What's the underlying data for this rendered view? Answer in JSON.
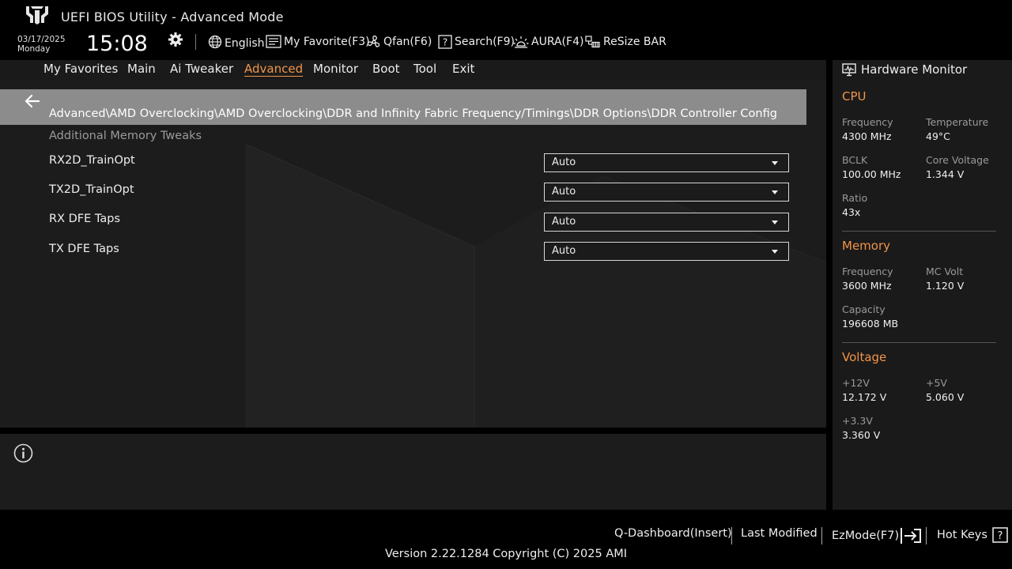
{
  "header": {
    "title": "UEFI BIOS Utility - Advanced Mode",
    "date": "03/17/2025",
    "day": "Monday",
    "time": "15:08",
    "tools": {
      "language": "English",
      "favorite": "My Favorite(F3)",
      "qfan": "Qfan(F6)",
      "search": "Search(F9)",
      "aura": "AURA(F4)",
      "resize_bar": "ReSize BAR"
    }
  },
  "nav": {
    "tabs": [
      "My Favorites",
      "Main",
      "Ai Tweaker",
      "Advanced",
      "Monitor",
      "Boot",
      "Tool",
      "Exit"
    ],
    "active": "Advanced"
  },
  "main": {
    "path": "Advanced\\AMD Overclocking\\AMD Overclocking\\DDR and Infinity Fabric Frequency/Timings\\DDR Options\\DDR Controller Configuration\\Additional Memory Tweaks",
    "section": "Additional Memory Tweaks",
    "rows": [
      {
        "label": "RX2D_TrainOpt",
        "value": "Auto"
      },
      {
        "label": "TX2D_TrainOpt",
        "value": "Auto"
      },
      {
        "label": "RX DFE Taps",
        "value": "Auto"
      },
      {
        "label": "TX DFE Taps",
        "value": "Auto"
      }
    ]
  },
  "hw": {
    "title": "Hardware Monitor",
    "cpu": {
      "section": "CPU",
      "frequency_label": "Frequency",
      "frequency": "4300 MHz",
      "temperature_label": "Temperature",
      "temperature": "49°C",
      "bclk_label": "BCLK",
      "bclk": "100.00 MHz",
      "core_voltage_label": "Core Voltage",
      "core_voltage": "1.344 V",
      "ratio_label": "Ratio",
      "ratio": "43x"
    },
    "memory": {
      "section": "Memory",
      "frequency_label": "Frequency",
      "frequency": "3600 MHz",
      "mc_volt_label": "MC Volt",
      "mc_volt": "1.120 V",
      "capacity_label": "Capacity",
      "capacity": "196608 MB"
    },
    "voltage": {
      "section": "Voltage",
      "v12_label": "+12V",
      "v12": "12.172 V",
      "v5_label": "+5V",
      "v5": "5.060 V",
      "v33_label": "+3.3V",
      "v33": "3.360 V"
    }
  },
  "footer": {
    "qdashboard": "Q-Dashboard(Insert)",
    "last_modified": "Last Modified",
    "ezmode": "EzMode(F7)",
    "hotkeys": "Hot Keys",
    "version": "Version 2.22.1284 Copyright (C) 2025 AMI"
  },
  "colors": {
    "accent": "#f0954a",
    "background": "#1c1c1c",
    "pathbar": "#8c8c8c"
  }
}
